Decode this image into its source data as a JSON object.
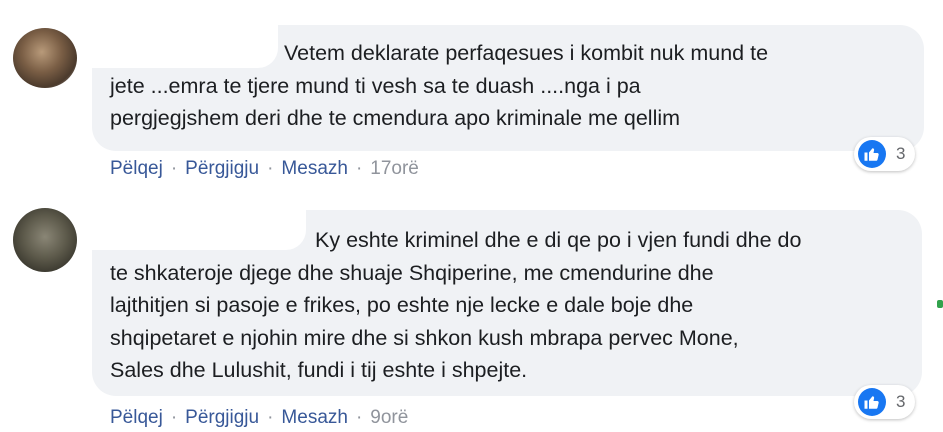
{
  "comments": [
    {
      "lines": [
        "Vetem deklarate perfaqesues i kombit nuk mund te",
        "jete ...emra te tjere mund ti vesh sa te duash ....nga i pa",
        "pergjegjshem deri dhe te cmendura apo kriminale me qellim"
      ],
      "reaction_count": "3",
      "actions": {
        "like": "Pëlqej",
        "reply": "Përgjigju",
        "message": "Mesazh",
        "time": "17orë"
      }
    },
    {
      "lines": [
        "Ky eshte kriminel dhe e di qe po i vjen fundi dhe do",
        "te shkateroje djege dhe shuaje Shqiperine, me cmendurine dhe",
        "lajthitjen si pasoje e frikes, po eshte nje lecke e dale boje dhe",
        "shqipetaret e njohin mire dhe si shkon kush mbrapa pervec Mone,",
        "Sales dhe Lulushit, fundi i tij eshte i shpejte."
      ],
      "reaction_count": "3",
      "actions": {
        "like": "Pëlqej",
        "reply": "Përgjigju",
        "message": "Mesazh",
        "time": "9orë"
      }
    }
  ],
  "separator": "·",
  "colors": {
    "bubble": "#f0f2f5",
    "link": "#385898",
    "like_blue": "#1877f2",
    "muted": "#90949c"
  },
  "icons": {
    "reaction": "like-thumbs-up-icon"
  }
}
